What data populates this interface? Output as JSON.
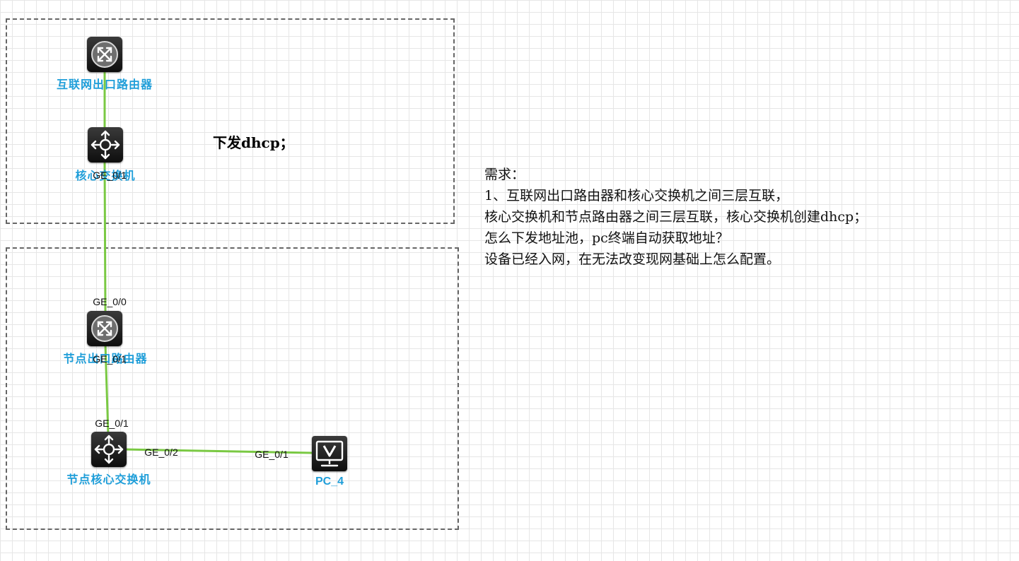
{
  "topology": {
    "devices": [
      {
        "id": "internet-router",
        "label": "互联网出口路由器",
        "type": "router"
      },
      {
        "id": "core-switch",
        "label": "核心交换机",
        "type": "switch"
      },
      {
        "id": "node-router",
        "label": "节点出口路由器",
        "type": "router"
      },
      {
        "id": "node-core-switch",
        "label": "节点核心交换机",
        "type": "switch"
      },
      {
        "id": "pc4",
        "label": "PC_4",
        "type": "pc"
      }
    ],
    "links": [
      {
        "from": "internet-router",
        "to": "core-switch"
      },
      {
        "from": "core-switch",
        "to": "node-router"
      },
      {
        "from": "node-router",
        "to": "node-core-switch"
      },
      {
        "from": "node-core-switch",
        "to": "pc4"
      }
    ],
    "ports": [
      {
        "device": "core-switch",
        "label": "GE_0/1"
      },
      {
        "device": "node-router",
        "label": "GE_0/0"
      },
      {
        "device": "node-router",
        "label": "GE_0/1"
      },
      {
        "device": "node-core-switch",
        "label": "GE_0/1"
      },
      {
        "device": "node-core-switch",
        "label": "GE_0/2"
      },
      {
        "device": "pc4",
        "label": "GE_0/1"
      }
    ],
    "link_color": "#7ac943",
    "label_color": "#1f9ed9"
  },
  "notes": {
    "top_zone": "下发dhcp；"
  },
  "requirements": [
    "需求：",
    "1、互联网出口路由器和核心交换机之间三层互联，",
    "核心交换机和节点路由器之间三层互联，核心交换机创建dhcp；",
    "怎么下发地址池，pc终端自动获取地址？",
    "设备已经入网，在无法改变现网基础上怎么配置。"
  ]
}
